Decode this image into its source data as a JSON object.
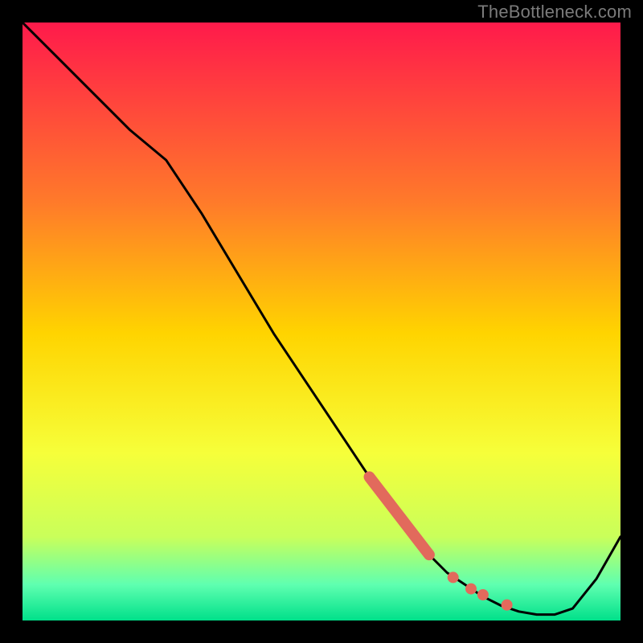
{
  "watermark": "TheBottleneck.com",
  "colors": {
    "bg_black": "#000000",
    "grad_top": "#ff1a4b",
    "grad_mid_upper": "#ff7a2a",
    "grad_mid": "#ffd400",
    "grad_mid_lower": "#f6ff3a",
    "grad_low1": "#c9ff5a",
    "grad_low2": "#5fffb0",
    "grad_bottom": "#00e08a",
    "curve": "#000000",
    "marker": "#e26a5c"
  },
  "chart_data": {
    "type": "line",
    "title": "",
    "xlabel": "",
    "ylabel": "",
    "xlim": [
      0,
      100
    ],
    "ylim": [
      0,
      100
    ],
    "grid": false,
    "series": [
      {
        "name": "bottleneck-curve",
        "x": [
          0,
          6,
          12,
          18,
          24,
          30,
          36,
          42,
          48,
          54,
          60,
          64,
          68,
          71,
          74,
          77,
          80,
          83,
          86,
          89,
          92,
          96,
          100
        ],
        "y": [
          100,
          94,
          88,
          82,
          77,
          68,
          58,
          48,
          39,
          30,
          21,
          16,
          11,
          8,
          6,
          4,
          2.5,
          1.5,
          1,
          1,
          2,
          7,
          14
        ]
      }
    ],
    "markers": {
      "thick_segment": {
        "x0": 58,
        "y0": 24,
        "x1": 68,
        "y1": 11
      },
      "dots": [
        {
          "x": 72,
          "y": 7.2
        },
        {
          "x": 75,
          "y": 5.3
        },
        {
          "x": 77,
          "y": 4.3
        },
        {
          "x": 81,
          "y": 2.6
        }
      ]
    }
  }
}
